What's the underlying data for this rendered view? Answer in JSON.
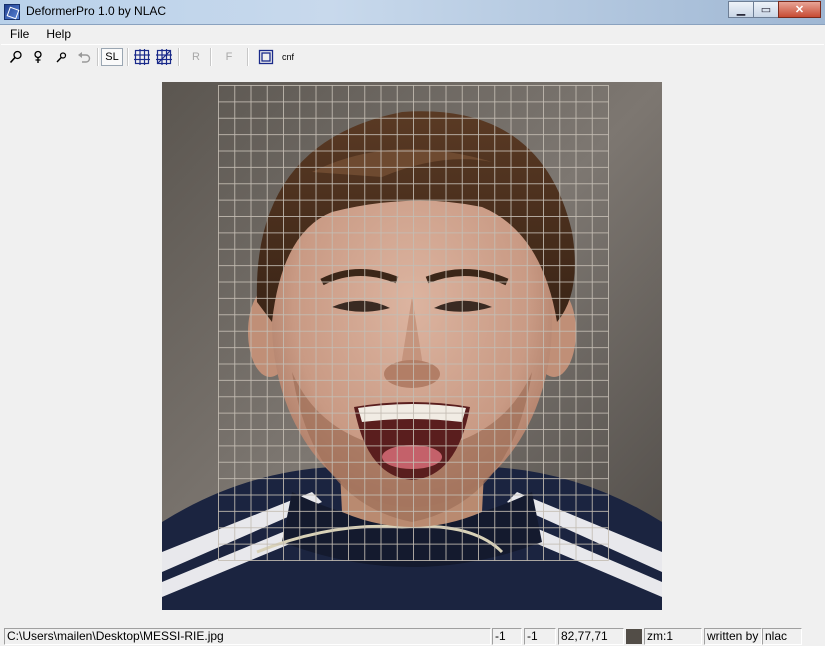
{
  "app": {
    "title": "DeformerPro 1.0 by NLAC",
    "window_buttons": {
      "minimize": "▁",
      "maximize": "▭",
      "close": "✕"
    }
  },
  "menu": [
    {
      "label": "File"
    },
    {
      "label": "Help"
    }
  ],
  "toolbar": {
    "sl_label": "SL",
    "r_label": "R",
    "f_label": "F",
    "cnf_label": "cnf",
    "icons": [
      "zoom-icon",
      "pin-icon",
      "small-zoom-icon",
      "undo-icon",
      "grid-icon",
      "grid-diagonal-icon",
      "frame-icon"
    ]
  },
  "statusbar": {
    "path": "C:\\Users\\mailen\\Desktop\\MESSI-RIE.jpg",
    "x": "-1",
    "y": "-1",
    "rgb": "82,77,71",
    "color": "#524d47",
    "zoom": "zm:1",
    "written_by": "written by",
    "author": "nlac"
  },
  "grid": {
    "columns": 24,
    "rows": 29
  }
}
